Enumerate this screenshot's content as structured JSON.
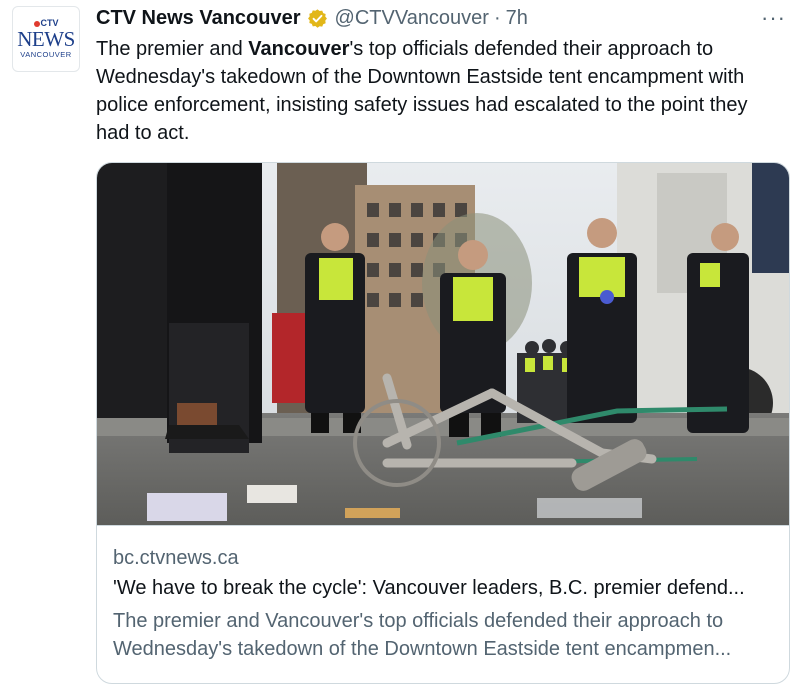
{
  "account": {
    "avatar_logo_top": "CTV",
    "avatar_logo_main": "NEWS",
    "avatar_logo_sub": "VANCOUVER",
    "name": "CTV News Vancouver",
    "handle": "@CTVVancouver",
    "separator": "·",
    "time": "7h",
    "verified_color": "#e2b719"
  },
  "menu": {
    "more_label": "···"
  },
  "tweet": {
    "text_part1": "The premier and ",
    "text_bold": "Vancouver",
    "text_part2": "'s top officials defended their approach to Wednesday's takedown of the Downtown Eastside tent encampment with police enforcement, insisting safety issues had escalated to the point they had to act."
  },
  "card": {
    "domain": "bc.ctvnews.ca",
    "title": "'We have to break the cycle': Vancouver leaders, B.C. premier defend...",
    "description_line1": "The premier and Vancouver's top officials defended their approach to",
    "description_line2": "Wednesday's takedown of the Downtown Eastside tent encampmen..."
  },
  "colors": {
    "text_primary": "#0f1419",
    "text_secondary": "#536471",
    "border": "#cfd9de",
    "hi_vis_vest": "#c8e63a"
  }
}
